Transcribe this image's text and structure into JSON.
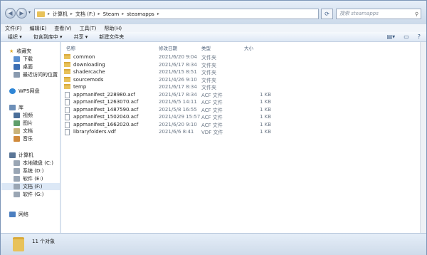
{
  "address": {
    "segments": [
      "计算机",
      "文档 (F:)",
      "Steam",
      "steamapps"
    ]
  },
  "search": {
    "placeholder": "搜索 steamapps"
  },
  "menu": [
    "文件(F)",
    "编辑(E)",
    "查看(V)",
    "工具(T)",
    "帮助(H)"
  ],
  "toolbar": {
    "organize": "组织 ▾",
    "include": "包含到库中 ▾",
    "share": "共享 ▾",
    "new_folder": "新建文件夹"
  },
  "nav": {
    "favorites": "收藏夹",
    "fav_items": [
      "下载",
      "桌面",
      "最近访问的位置"
    ],
    "wps": "WPS网盘",
    "libraries": "库",
    "lib_items": [
      "视频",
      "图片",
      "文档",
      "音乐"
    ],
    "computer": "计算机",
    "drives": [
      "本地磁盘 (C:)",
      "系统 (D:)",
      "软件 (E:)",
      "文档 (F:)",
      "软件 (G:)"
    ],
    "network": "网络"
  },
  "columns": {
    "name": "名称",
    "date": "修改日期",
    "type": "类型",
    "size": "大小"
  },
  "files": [
    {
      "name": "common",
      "date": "2021/6/20 9:04",
      "type": "文件夹",
      "size": "",
      "kind": "folder"
    },
    {
      "name": "downloading",
      "date": "2021/6/17 8:34",
      "type": "文件夹",
      "size": "",
      "kind": "folder"
    },
    {
      "name": "shadercache",
      "date": "2021/6/15 8:51",
      "type": "文件夹",
      "size": "",
      "kind": "folder"
    },
    {
      "name": "sourcemods",
      "date": "2021/4/26 9:10",
      "type": "文件夹",
      "size": "",
      "kind": "folder"
    },
    {
      "name": "temp",
      "date": "2021/6/17 8:34",
      "type": "文件夹",
      "size": "",
      "kind": "folder"
    },
    {
      "name": "appmanifest_228980.acf",
      "date": "2021/6/17 8:34",
      "type": "ACF 文件",
      "size": "1 KB",
      "kind": "file"
    },
    {
      "name": "appmanifest_1263070.acf",
      "date": "2021/6/5 14:11",
      "type": "ACF 文件",
      "size": "1 KB",
      "kind": "file"
    },
    {
      "name": "appmanifest_1487590.acf",
      "date": "2021/5/8 16:55",
      "type": "ACF 文件",
      "size": "1 KB",
      "kind": "file"
    },
    {
      "name": "appmanifest_1502040.acf",
      "date": "2021/4/29 15:57",
      "type": "ACF 文件",
      "size": "1 KB",
      "kind": "file"
    },
    {
      "name": "appmanifest_1662020.acf",
      "date": "2021/6/20 9:10",
      "type": "ACF 文件",
      "size": "1 KB",
      "kind": "file"
    },
    {
      "name": "libraryfolders.vdf",
      "date": "2021/6/6 8:41",
      "type": "VDF 文件",
      "size": "1 KB",
      "kind": "file"
    }
  ],
  "status": {
    "count": "11 个对象"
  },
  "colors": {
    "folder": "#e8c25a",
    "selection": "#dce8f6",
    "chrome": "#dbe6f3"
  }
}
